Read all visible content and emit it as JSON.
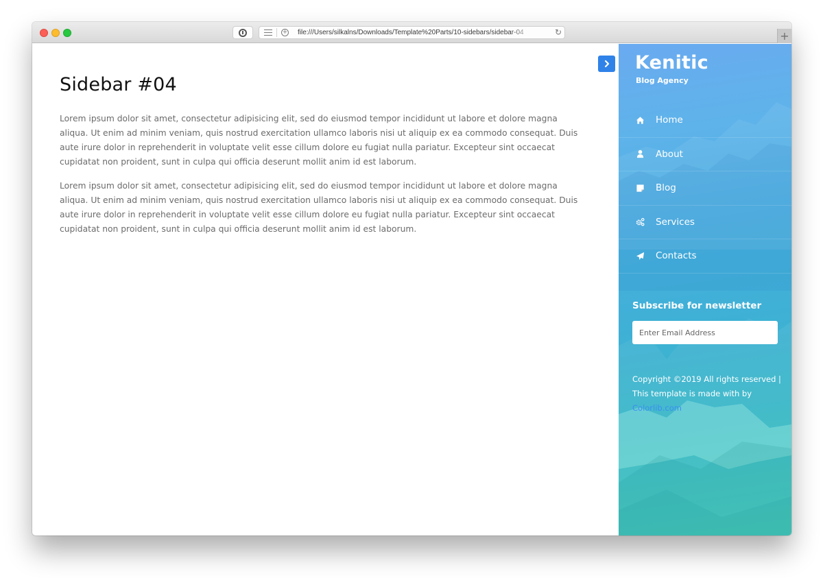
{
  "browser": {
    "url": "file:///Users/silkalns/Downloads/Template%20Parts/10-sidebars/sidebar-04",
    "new_tab_symbol": "+",
    "reload_symbol": "↻",
    "add_symbol": "+"
  },
  "main": {
    "title": "Sidebar #04",
    "paragraphs": [
      "Lorem ipsum dolor sit amet, consectetur adipisicing elit, sed do eiusmod tempor incididunt ut labore et dolore magna aliqua. Ut enim ad minim veniam, quis nostrud exercitation ullamco laboris nisi ut aliquip ex ea commodo consequat. Duis aute irure dolor in reprehenderit in voluptate velit esse cillum dolore eu fugiat nulla pariatur. Excepteur sint occaecat cupidatat non proident, sunt in culpa qui officia deserunt mollit anim id est laborum.",
      "Lorem ipsum dolor sit amet, consectetur adipisicing elit, sed do eiusmod tempor incididunt ut labore et dolore magna aliqua. Ut enim ad minim veniam, quis nostrud exercitation ullamco laboris nisi ut aliquip ex ea commodo consequat. Duis aute irure dolor in reprehenderit in voluptate velit esse cillum dolore eu fugiat nulla pariatur. Excepteur sint occaecat cupidatat non proident, sunt in culpa qui officia deserunt mollit anim id est laborum."
    ]
  },
  "sidebar": {
    "brand": "Kenitic",
    "tagline": "Blog Agency",
    "toggle_icon": "chevron-right-icon",
    "nav": [
      {
        "label": "Home",
        "icon": "home-icon"
      },
      {
        "label": "About",
        "icon": "user-icon"
      },
      {
        "label": "Blog",
        "icon": "sticky-note-icon"
      },
      {
        "label": "Services",
        "icon": "cogs-icon"
      },
      {
        "label": "Contacts",
        "icon": "paper-plane-icon"
      }
    ],
    "newsletter": {
      "title": "Subscribe for newsletter",
      "placeholder": "Enter Email Address"
    },
    "copyright": {
      "text": "Copyright ©2019 All rights reserved | This template is made with by ",
      "link": "Colorlib.com"
    }
  },
  "colors": {
    "accent": "#2f82e8",
    "sidebar_top": "#6aaaf0",
    "sidebar_bottom": "#40c9b7",
    "link": "#3b8ff0"
  }
}
